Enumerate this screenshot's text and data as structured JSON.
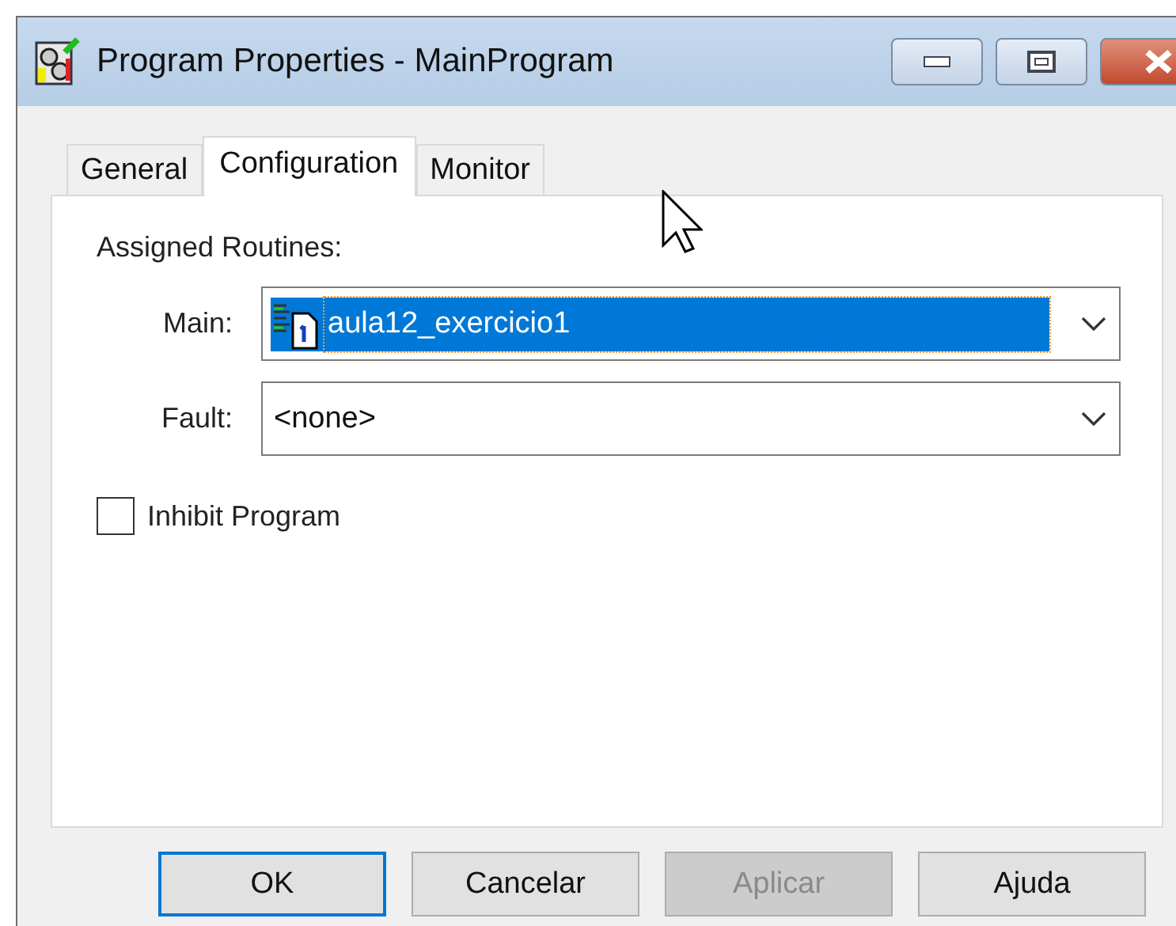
{
  "window": {
    "title": "Program Properties - MainProgram"
  },
  "tabs": [
    {
      "label": "General",
      "selected": false
    },
    {
      "label": "Configuration",
      "selected": true
    },
    {
      "label": "Monitor",
      "selected": false
    }
  ],
  "section_label": "Assigned Routines:",
  "fields": [
    {
      "label": "Main:",
      "value": "aula12_exercicio1",
      "highlighted": true,
      "kind": "routine"
    },
    {
      "label": "Fault:",
      "value": "<none>",
      "highlighted": false,
      "kind": "plain"
    }
  ],
  "checkbox": {
    "label": "Inhibit Program",
    "checked": false
  },
  "buttons": [
    {
      "label": "OK",
      "default": true,
      "disabled": false
    },
    {
      "label": "Cancelar",
      "default": false,
      "disabled": false
    },
    {
      "label": "Aplicar",
      "default": false,
      "disabled": true
    },
    {
      "label": "Ajuda",
      "default": false,
      "disabled": false
    }
  ]
}
